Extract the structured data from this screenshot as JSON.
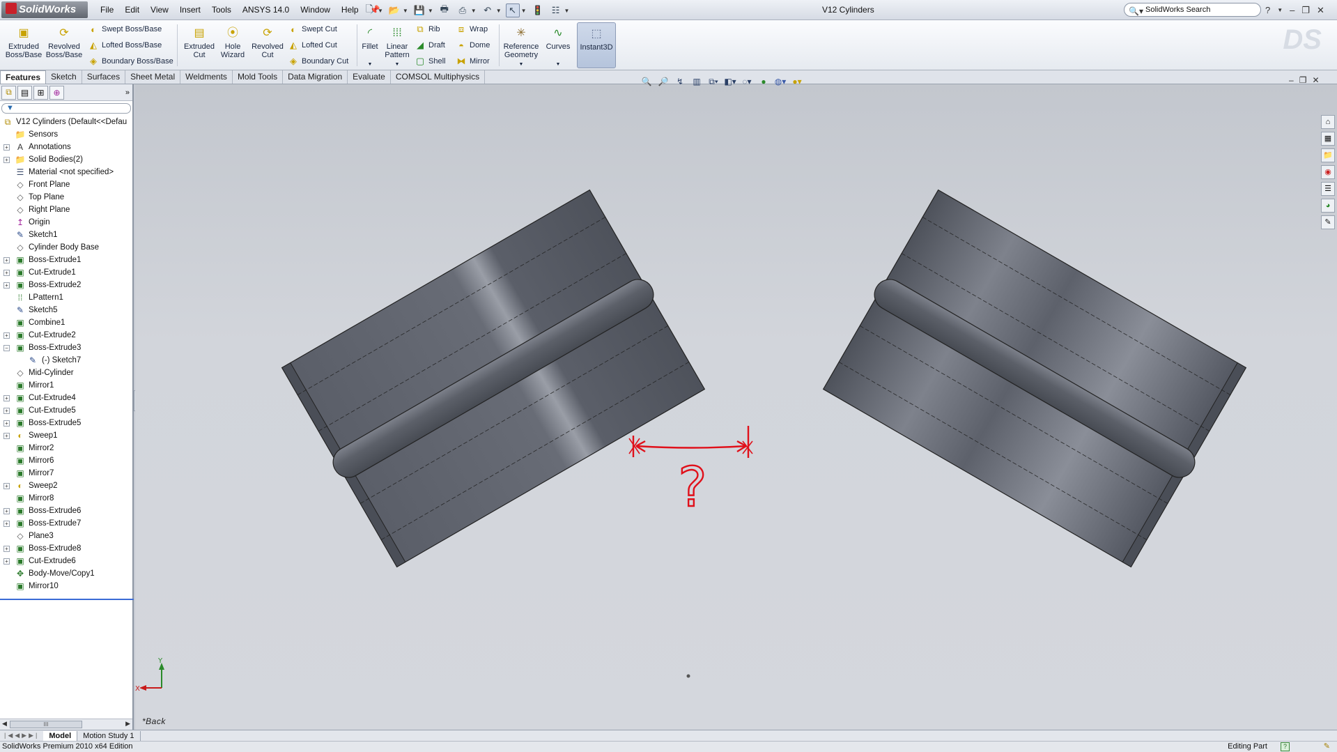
{
  "app": {
    "logo_text": "SolidWorks",
    "document_title": "V12 Cylinders"
  },
  "menus": [
    "File",
    "Edit",
    "View",
    "Insert",
    "Tools",
    "ANSYS 14.0",
    "Window",
    "Help"
  ],
  "search": {
    "placeholder": "SolidWorks Search"
  },
  "window_controls": {
    "help": "?",
    "minimize": "–",
    "restore": "❐",
    "close": "✕"
  },
  "ribbon": {
    "extruded_boss": "Extruded Boss/Base",
    "revolved_boss": "Revolved Boss/Base",
    "swept_boss": "Swept Boss/Base",
    "lofted_boss": "Lofted Boss/Base",
    "boundary_boss": "Boundary Boss/Base",
    "extruded_cut": "Extruded Cut",
    "hole_wizard": "Hole Wizard",
    "revolved_cut": "Revolved Cut",
    "swept_cut": "Swept Cut",
    "lofted_cut": "Lofted Cut",
    "boundary_cut": "Boundary Cut",
    "fillet": "Fillet",
    "linear_pattern": "Linear Pattern",
    "rib": "Rib",
    "draft": "Draft",
    "shell": "Shell",
    "wrap": "Wrap",
    "dome": "Dome",
    "mirror": "Mirror",
    "reference_geometry": "Reference Geometry",
    "curves": "Curves",
    "instant3d": "Instant3D"
  },
  "tabs": [
    "Features",
    "Sketch",
    "Surfaces",
    "Sheet Metal",
    "Weldments",
    "Mold Tools",
    "Data Migration",
    "Evaluate",
    "COMSOL Multiphysics"
  ],
  "feature_tree": {
    "root": "V12 Cylinders  (Default<<Defau",
    "items": [
      {
        "label": "Sensors",
        "icon": "sensor-folder-icon",
        "glyph": "📁",
        "expand": false
      },
      {
        "label": "Annotations",
        "icon": "annotation-icon",
        "glyph": "A",
        "expand": true
      },
      {
        "label": "Solid Bodies(2)",
        "icon": "solid-bodies-icon",
        "glyph": "📁",
        "expand": true
      },
      {
        "label": "Material <not specified>",
        "icon": "material-icon",
        "glyph": "☰",
        "expand": false
      },
      {
        "label": "Front Plane",
        "icon": "plane-icon",
        "glyph": "◇",
        "expand": false
      },
      {
        "label": "Top Plane",
        "icon": "plane-icon",
        "glyph": "◇",
        "expand": false
      },
      {
        "label": "Right Plane",
        "icon": "plane-icon",
        "glyph": "◇",
        "expand": false
      },
      {
        "label": "Origin",
        "icon": "origin-icon",
        "glyph": "↥",
        "expand": false
      },
      {
        "label": "Sketch1",
        "icon": "sketch-icon",
        "glyph": "✎",
        "expand": false
      },
      {
        "label": "Cylinder Body Base",
        "icon": "plane-icon",
        "glyph": "◇",
        "expand": false
      },
      {
        "label": "Boss-Extrude1",
        "icon": "boss-extrude-icon",
        "glyph": "▣",
        "expand": true
      },
      {
        "label": "Cut-Extrude1",
        "icon": "cut-extrude-icon",
        "glyph": "▣",
        "expand": true
      },
      {
        "label": "Boss-Extrude2",
        "icon": "boss-extrude-icon",
        "glyph": "▣",
        "expand": true
      },
      {
        "label": "LPattern1",
        "icon": "linear-pattern-icon",
        "glyph": "⁞⁞",
        "expand": false
      },
      {
        "label": "Sketch5",
        "icon": "sketch-icon",
        "glyph": "✎",
        "expand": false
      },
      {
        "label": "Combine1",
        "icon": "combine-icon",
        "glyph": "▣",
        "expand": false
      },
      {
        "label": "Cut-Extrude2",
        "icon": "cut-extrude-icon",
        "glyph": "▣",
        "expand": true
      },
      {
        "label": "Boss-Extrude3",
        "icon": "boss-extrude-icon",
        "glyph": "▣",
        "expand": true,
        "expanded": true
      },
      {
        "label": "(-) Sketch7",
        "icon": "sketch-icon",
        "glyph": "✎",
        "expand": false,
        "child": true
      },
      {
        "label": "Mid-Cylinder",
        "icon": "plane-icon",
        "glyph": "◇",
        "expand": false
      },
      {
        "label": "Mirror1",
        "icon": "mirror-icon",
        "glyph": "▣",
        "expand": false
      },
      {
        "label": "Cut-Extrude4",
        "icon": "cut-extrude-icon",
        "glyph": "▣",
        "expand": true
      },
      {
        "label": "Cut-Extrude5",
        "icon": "cut-extrude-icon",
        "glyph": "▣",
        "expand": true
      },
      {
        "label": "Boss-Extrude5",
        "icon": "boss-extrude-icon",
        "glyph": "▣",
        "expand": true
      },
      {
        "label": "Sweep1",
        "icon": "sweep-icon",
        "glyph": "◐",
        "expand": true
      },
      {
        "label": "Mirror2",
        "icon": "mirror-icon",
        "glyph": "▣",
        "expand": false
      },
      {
        "label": "Mirror6",
        "icon": "mirror-icon",
        "glyph": "▣",
        "expand": false
      },
      {
        "label": "Mirror7",
        "icon": "mirror-icon",
        "glyph": "▣",
        "expand": false
      },
      {
        "label": "Sweep2",
        "icon": "sweep-icon",
        "glyph": "◐",
        "expand": true
      },
      {
        "label": "Mirror8",
        "icon": "mirror-icon",
        "glyph": "▣",
        "expand": false
      },
      {
        "label": "Boss-Extrude6",
        "icon": "boss-extrude-icon",
        "glyph": "▣",
        "expand": true
      },
      {
        "label": "Boss-Extrude7",
        "icon": "boss-extrude-icon",
        "glyph": "▣",
        "expand": true
      },
      {
        "label": "Plane3",
        "icon": "plane-icon",
        "glyph": "◇",
        "expand": false
      },
      {
        "label": "Boss-Extrude8",
        "icon": "boss-extrude-icon",
        "glyph": "▣",
        "expand": true
      },
      {
        "label": "Cut-Extrude6",
        "icon": "cut-extrude-icon",
        "glyph": "▣",
        "expand": true
      },
      {
        "label": "Body-Move/Copy1",
        "icon": "body-move-icon",
        "glyph": "✥",
        "expand": false
      },
      {
        "label": "Mirror10",
        "icon": "mirror-icon",
        "glyph": "▣",
        "expand": false
      }
    ]
  },
  "viewport": {
    "view_label": "*Back",
    "triad_x": "X",
    "triad_y": "Y",
    "annotation_symbol": "?"
  },
  "bottom_tabs": [
    "Model",
    "Motion Study 1"
  ],
  "status": {
    "left": "SolidWorks Premium 2010 x64 Edition",
    "right": "Editing Part",
    "help": "?"
  },
  "colors": {
    "accent": "#3b6bd6",
    "annotation_red": "#e0101a",
    "part_gray": "#5f636d"
  }
}
